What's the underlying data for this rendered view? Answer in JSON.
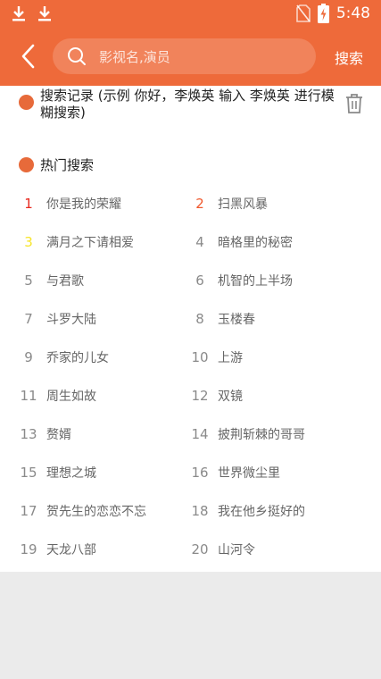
{
  "status_bar": {
    "time": "5:48",
    "icons": [
      "download-icon",
      "download-icon",
      "no-sim-icon",
      "battery-charging-icon"
    ]
  },
  "header": {
    "search_placeholder": "影视名,演员",
    "search_button": "搜索",
    "icons": [
      "back-arrow-icon",
      "search-icon"
    ]
  },
  "history": {
    "title": "搜索记录 (示例 你好，李焕英 输入 李焕英 进行模糊搜索)",
    "icons": [
      "trash-icon"
    ]
  },
  "hot": {
    "title": "热门搜索",
    "items": [
      {
        "rank": "1",
        "name": "你是我的荣耀"
      },
      {
        "rank": "2",
        "name": "扫黑风暴"
      },
      {
        "rank": "3",
        "name": "满月之下请相爱"
      },
      {
        "rank": "4",
        "name": "暗格里的秘密"
      },
      {
        "rank": "5",
        "name": "与君歌"
      },
      {
        "rank": "6",
        "name": "机智的上半场"
      },
      {
        "rank": "7",
        "name": "斗罗大陆"
      },
      {
        "rank": "8",
        "name": "玉楼春"
      },
      {
        "rank": "9",
        "name": "乔家的儿女"
      },
      {
        "rank": "10",
        "name": "上游"
      },
      {
        "rank": "11",
        "name": "周生如故"
      },
      {
        "rank": "12",
        "name": "双镜"
      },
      {
        "rank": "13",
        "name": "赘婿"
      },
      {
        "rank": "14",
        "name": "披荆斩棘的哥哥"
      },
      {
        "rank": "15",
        "name": "理想之城"
      },
      {
        "rank": "16",
        "name": "世界微尘里"
      },
      {
        "rank": "17",
        "name": "贺先生的恋恋不忘"
      },
      {
        "rank": "18",
        "name": "我在他乡挺好的"
      },
      {
        "rank": "19",
        "name": "天龙八部"
      },
      {
        "rank": "20",
        "name": "山河令"
      }
    ]
  },
  "colors": {
    "accent": "#ee6a3a",
    "rank_1": "#e8281e",
    "rank_2": "#f0572b",
    "rank_3": "#f7e52b",
    "rank_default": "#8a8a8a"
  }
}
